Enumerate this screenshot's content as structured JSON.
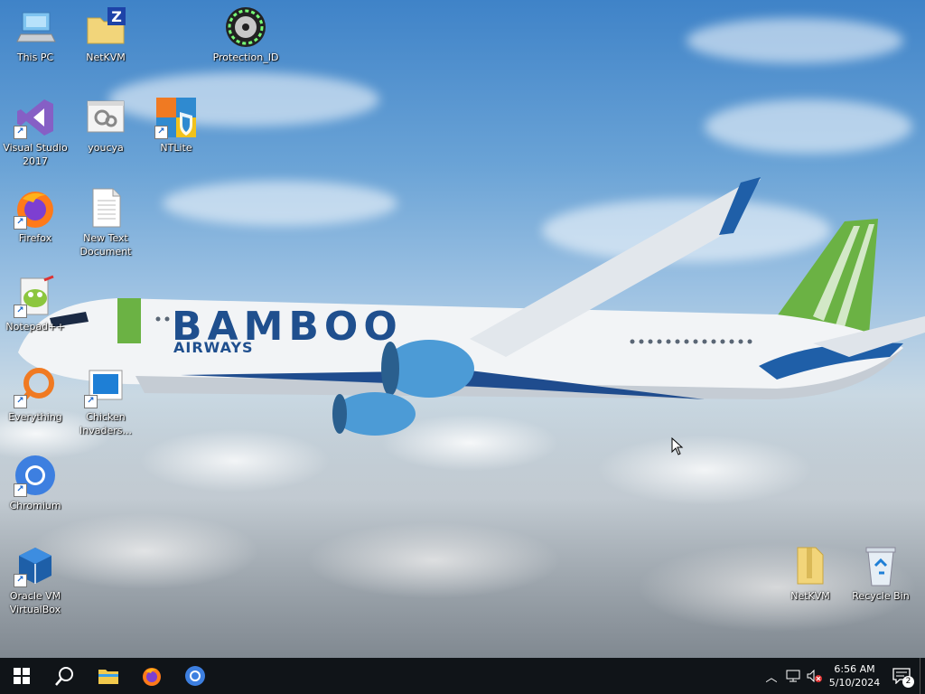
{
  "desktop": {
    "wallpaper": {
      "airline_name": "BAMBOO",
      "airline_sub": "AIRWAYS"
    },
    "icons": [
      {
        "label": "This PC",
        "icon": "this-pc-icon"
      },
      {
        "label": "NetKVM",
        "icon": "archive-folder-icon"
      },
      {
        "label": "Protection_ID",
        "icon": "disc-icon"
      },
      {
        "label": "Visual Studio 2017",
        "icon": "visual-studio-icon"
      },
      {
        "label": "youcya",
        "icon": "settings-window-icon"
      },
      {
        "label": "NTLite",
        "icon": "ntlite-icon"
      },
      {
        "label": "Firefox",
        "icon": "firefox-icon"
      },
      {
        "label": "New Text Document",
        "icon": "text-document-icon"
      },
      {
        "label": "Notepad++",
        "icon": "notepadpp-icon"
      },
      {
        "label": "Everything",
        "icon": "everything-search-icon"
      },
      {
        "label": "Chicken Invaders...",
        "icon": "chicken-invaders-icon"
      },
      {
        "label": "Chromium",
        "icon": "chromium-icon"
      },
      {
        "label": "Oracle VM VirtualBox",
        "icon": "virtualbox-icon"
      },
      {
        "label": "NetKVM",
        "icon": "folder-icon"
      },
      {
        "label": "Recycle Bin",
        "icon": "recycle-bin-icon"
      }
    ]
  },
  "taskbar": {
    "pinned": [
      {
        "name": "start",
        "icon": "windows-start-icon"
      },
      {
        "name": "search",
        "icon": "search-icon"
      },
      {
        "name": "file-explorer",
        "icon": "file-explorer-icon"
      },
      {
        "name": "firefox",
        "icon": "firefox-icon"
      },
      {
        "name": "chromium",
        "icon": "chromium-icon"
      }
    ],
    "tray": {
      "time": "6:56 AM",
      "date": "5/10/2024",
      "notification_count": "2"
    }
  }
}
